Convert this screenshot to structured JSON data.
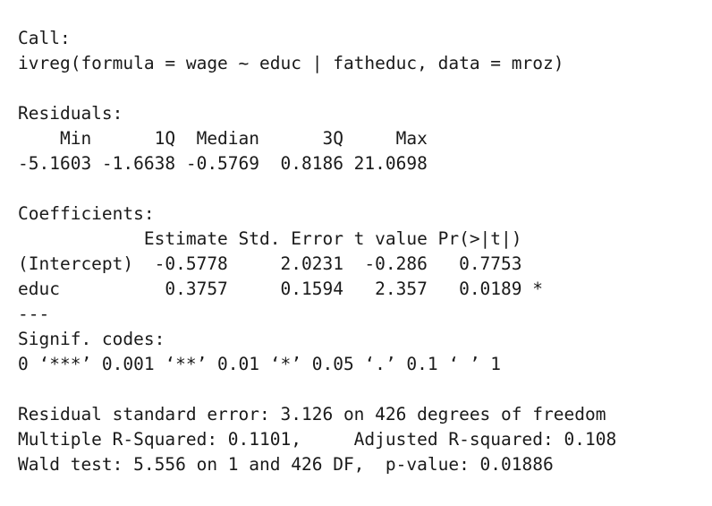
{
  "call": {
    "header": "Call:",
    "formula": "ivreg(formula = wage ~ educ | fatheduc, data = mroz)"
  },
  "residuals": {
    "header": "Residuals:",
    "labels": "    Min      1Q  Median      3Q     Max ",
    "values": "-5.1603 -1.6638 -0.5769  0.8186 21.0698 "
  },
  "coefficients": {
    "header": "Coefficients:",
    "columns": "            Estimate Std. Error t value Pr(>|t|)  ",
    "rows": [
      "(Intercept)  -0.5778     2.0231  -0.286   0.7753  ",
      "educ          0.3757     0.1594   2.357   0.0189 *"
    ],
    "separator": "---",
    "signif_header": "Signif. codes:",
    "signif_codes": "0 ‘***’ 0.001 ‘**’ 0.01 ‘*’ 0.05 ‘.’ 0.1 ‘ ’ 1"
  },
  "summary": {
    "residual_se": "Residual standard error: 3.126 on 426 degrees of freedom",
    "r_squared": "Multiple R-Squared: 0.1101,     Adjusted R-squared: 0.108 ",
    "wald": "Wald test: 5.556 on 1 and 426 DF,  p-value: 0.01886"
  }
}
